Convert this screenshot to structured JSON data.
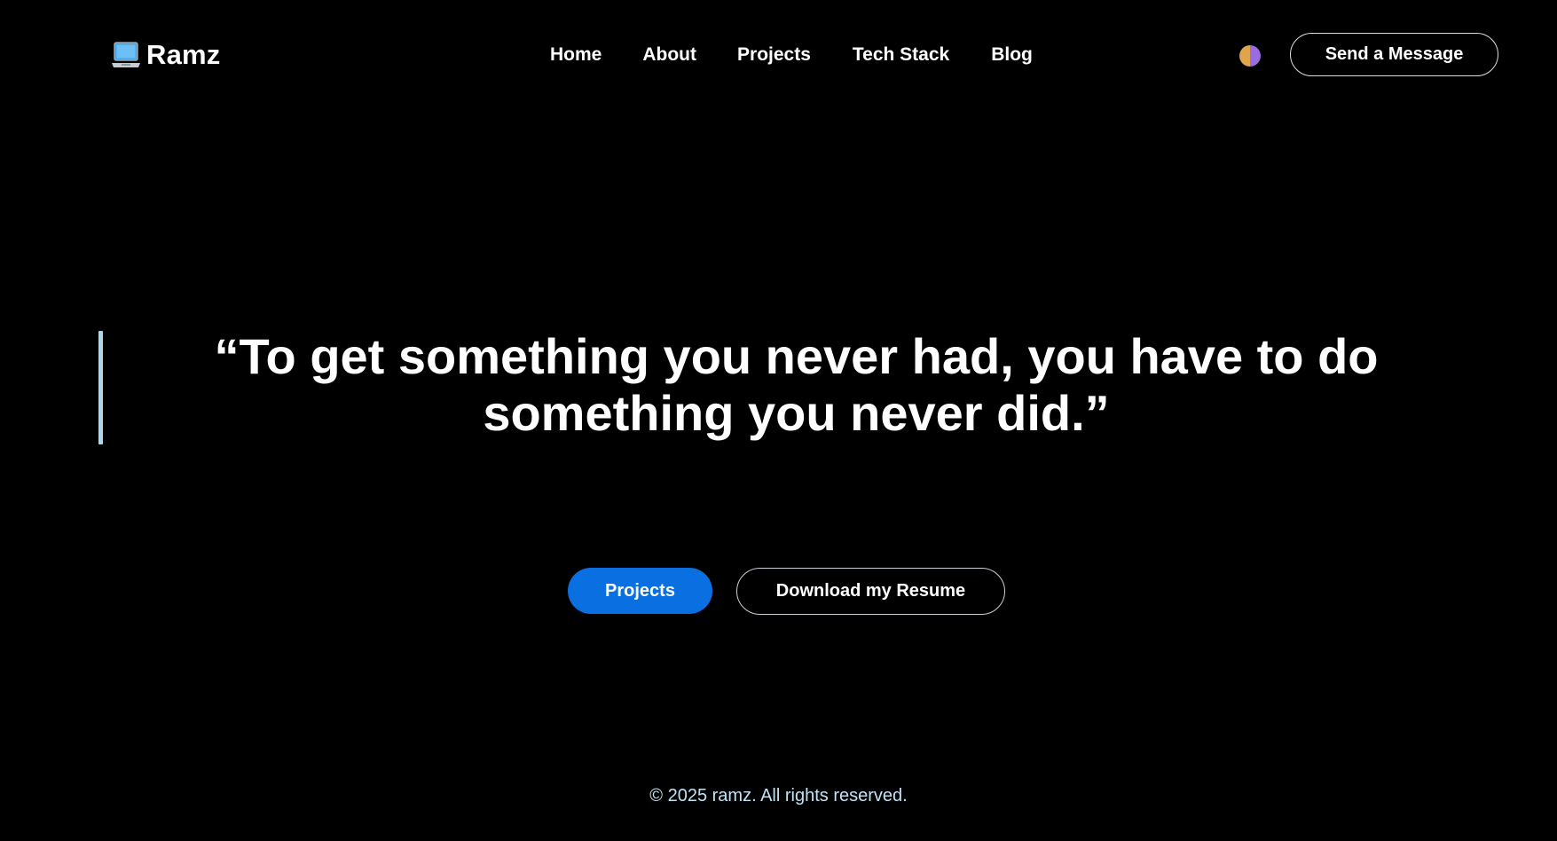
{
  "header": {
    "brand": "Ramz",
    "brand_icon": "laptop-icon",
    "nav": [
      {
        "label": "Home"
      },
      {
        "label": "About"
      },
      {
        "label": "Projects"
      },
      {
        "label": "Tech Stack"
      },
      {
        "label": "Blog"
      }
    ],
    "theme_toggle_icon": "theme-toggle-icon",
    "send_message_label": "Send a Message"
  },
  "hero": {
    "quote": "“To get something you never had, you have to do something you never did.”",
    "projects_button": "Projects",
    "resume_button": "Download my Resume"
  },
  "footer": {
    "copyright": "© 2025 ramz. All rights reserved."
  },
  "colors": {
    "background": "#000000",
    "primary_button": "#0a6fe0",
    "accent_bar": "#a8d8f0",
    "footer_text": "#bfe3f5"
  }
}
